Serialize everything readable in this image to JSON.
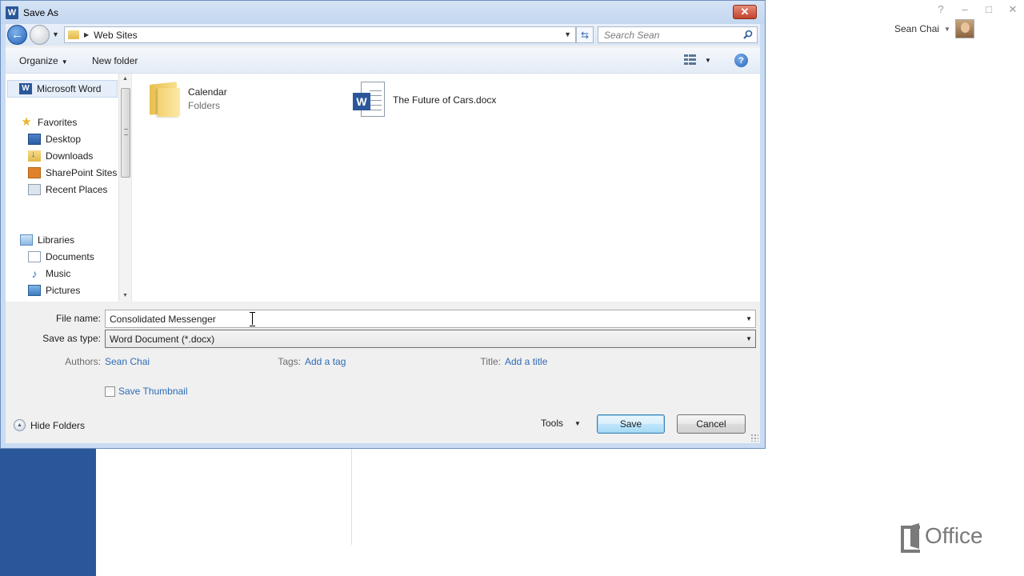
{
  "backstage": {
    "user_name": "Sean Chai",
    "help_icon": "?",
    "minimize_icon": "–",
    "maximize_icon": "□",
    "close_icon": "✕",
    "brand": "Office",
    "accent_color": "#2b579a"
  },
  "dialog": {
    "title": "Save As",
    "app_icon_letter": "W",
    "address": {
      "path": "Web Sites"
    },
    "search": {
      "placeholder": "Search Sean"
    },
    "toolbar": {
      "organize_label": "Organize",
      "new_folder_label": "New folder"
    },
    "nav": {
      "top_item": "Microsoft Word",
      "favorites": "Favorites",
      "favorites_items": [
        "Desktop",
        "Downloads",
        "SharePoint Sites",
        "Recent Places"
      ],
      "libraries": "Libraries",
      "library_items": [
        "Documents",
        "Music",
        "Pictures"
      ]
    },
    "files": [
      {
        "name": "Calendar",
        "type": "Folders",
        "icon": "folder-icon"
      },
      {
        "name": "The Future of Cars.docx",
        "type": "",
        "icon": "word-document-icon"
      }
    ],
    "form": {
      "file_name_label": "File name:",
      "file_name_value": "Consolidated Messenger",
      "save_type_label": "Save as type:",
      "save_type_value": "Word Document (*.docx)",
      "authors_label": "Authors:",
      "authors_value": "Sean Chai",
      "tags_label": "Tags:",
      "tags_value": "Add a tag",
      "title_label": "Title:",
      "title_value": "Add a title",
      "thumbnail_label": "Save Thumbnail",
      "thumbnail_checked": false
    },
    "footer": {
      "hide_folders_label": "Hide Folders",
      "tools_label": "Tools",
      "save_label": "Save",
      "cancel_label": "Cancel"
    }
  }
}
